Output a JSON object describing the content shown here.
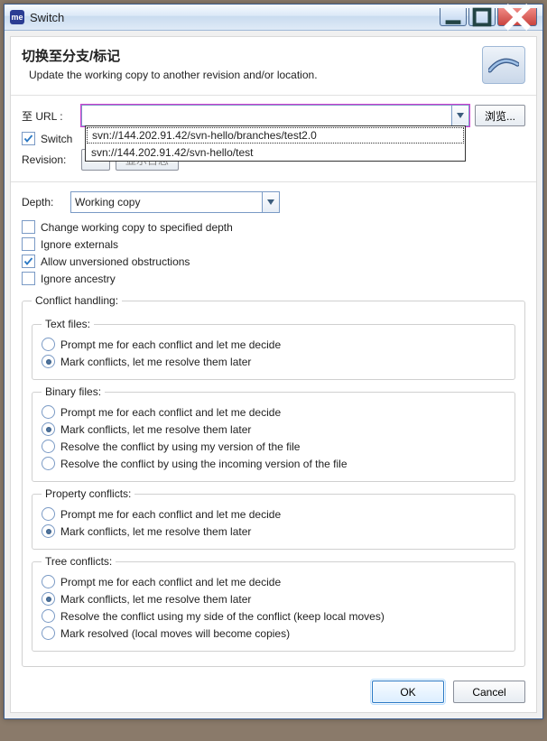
{
  "window": {
    "title": "Switch",
    "app_icon_text": "me"
  },
  "header": {
    "title": "切换至分支/标记",
    "subtitle": "Update the working copy to another revision and/or location."
  },
  "url_row": {
    "label": "至 URL :",
    "value": "",
    "browse": "浏览...",
    "options": [
      "svn://144.202.91.42/svn-hello/branches/test2.0",
      "svn://144.202.91.42/svn-hello/test"
    ],
    "selected_index": 0
  },
  "switch_row": {
    "checkbox_label_fragment": "Switch",
    "log_button": "显示日志"
  },
  "revision_row": {
    "label": "Revision:"
  },
  "depth": {
    "label": "Depth:",
    "value": "Working copy"
  },
  "options": {
    "change_depth": {
      "label": "Change working copy to specified depth",
      "checked": false
    },
    "ignore_externals": {
      "label": "Ignore externals",
      "checked": false
    },
    "allow_unversioned": {
      "label": "Allow unversioned obstructions",
      "checked": true
    },
    "ignore_ancestry": {
      "label": "Ignore ancestry",
      "checked": false
    }
  },
  "conflict": {
    "legend": "Conflict handling:",
    "text_files": {
      "legend": "Text files:",
      "options": [
        "Prompt me for each conflict and let me decide",
        "Mark conflicts, let me resolve them later"
      ],
      "selected": 1
    },
    "binary_files": {
      "legend": "Binary files:",
      "options": [
        "Prompt me for each conflict and let me decide",
        "Mark conflicts, let me resolve them later",
        "Resolve the conflict by using my version of the file",
        "Resolve the conflict by using the incoming version of the file"
      ],
      "selected": 1
    },
    "property": {
      "legend": "Property conflicts:",
      "options": [
        "Prompt me for each conflict and let me decide",
        "Mark conflicts, let me resolve them later"
      ],
      "selected": 1
    },
    "tree": {
      "legend": "Tree conflicts:",
      "options": [
        "Prompt me for each conflict and let me decide",
        "Mark conflicts, let me resolve them later",
        "Resolve the conflict using my side of the conflict (keep local moves)",
        "Mark resolved (local moves will become copies)"
      ],
      "selected": 1
    }
  },
  "footer": {
    "ok": "OK",
    "cancel": "Cancel"
  }
}
